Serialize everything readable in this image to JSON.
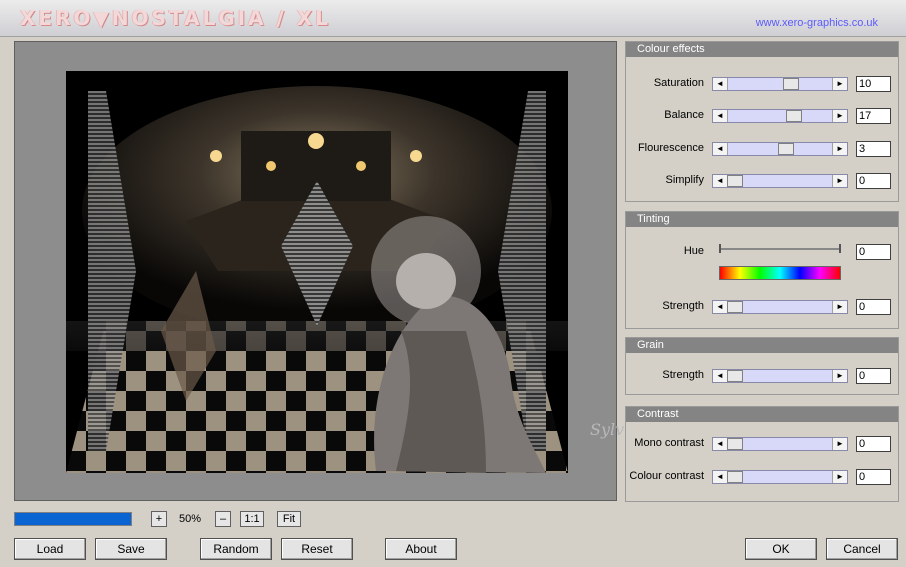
{
  "header": {
    "logo": "XERO▼NOSTALGIA / XL",
    "website": "www.xero-graphics.co.uk"
  },
  "panels": {
    "colour_effects": {
      "title": "Colour effects",
      "rows": [
        {
          "label": "Saturation",
          "value": "10",
          "level": 0.62
        },
        {
          "label": "Balance",
          "value": "17",
          "level": 0.66
        },
        {
          "label": "Flourescence",
          "value": "3",
          "level": 0.57
        },
        {
          "label": "Simplify",
          "value": "0",
          "level": 0.0
        }
      ]
    },
    "tinting": {
      "title": "Tinting",
      "hue": {
        "label": "Hue",
        "value": "0",
        "level": 0.0
      },
      "strength": {
        "label": "Strength",
        "value": "0",
        "level": 0.0
      }
    },
    "grain": {
      "title": "Grain",
      "strength": {
        "label": "Strength",
        "value": "0",
        "level": 0.0
      }
    },
    "contrast": {
      "title": "Contrast",
      "rows": [
        {
          "label": "Mono contrast",
          "value": "0",
          "level": 0.0
        },
        {
          "label": "Colour contrast",
          "value": "0",
          "level": 0.0
        }
      ]
    }
  },
  "preview_controls": {
    "progress": 1.0,
    "zoom_in": "+",
    "zoom_value": "50%",
    "zoom_out": "–",
    "actual_size": "1:1",
    "fit": "Fit"
  },
  "buttons": {
    "load": "Load",
    "save": "Save",
    "random": "Random",
    "reset": "Reset",
    "about": "About",
    "ok": "OK",
    "cancel": "Cancel"
  },
  "watermark": "Sylviane",
  "colors": {
    "accent_progress": "#0a64d2",
    "slider_track": "#d8d8f8",
    "panel_header": "#848484",
    "website_link": "#5a5aff"
  }
}
